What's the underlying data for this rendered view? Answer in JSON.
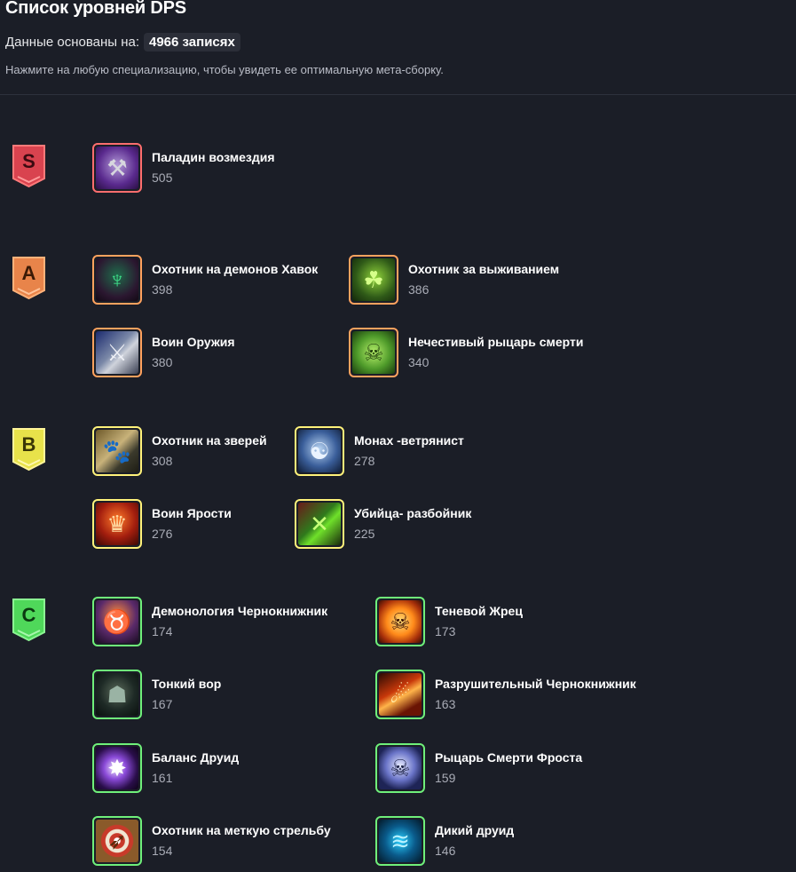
{
  "header": {
    "title": "Список уровней DPS",
    "basis_label": "Данные основаны на:",
    "basis_count": "4966 записях",
    "hint": "Нажмите на любую специализацию, чтобы увидеть ее оптимальную мета-сборку."
  },
  "colors": {
    "background": "#1b1e27",
    "tier_s": "#ff6e6e",
    "tier_a": "#ffa25e",
    "tier_b": "#fff27a",
    "tier_c": "#6ff07a"
  },
  "tiers": [
    {
      "letter": "S",
      "specs": [
        {
          "name": "Паладин возмездия",
          "count": "505",
          "icon": "hammer-icon"
        }
      ]
    },
    {
      "letter": "A",
      "specs": [
        {
          "name": "Охотник на демонов Хавок",
          "count": "398",
          "icon": "demon-hunter-icon"
        },
        {
          "name": "Охотник за выживанием",
          "count": "386",
          "icon": "survival-hunter-icon"
        },
        {
          "name": "Воин Оружия",
          "count": "380",
          "icon": "axe-icon"
        },
        {
          "name": "Нечестивый рыцарь смерти",
          "count": "340",
          "icon": "ghoul-icon"
        }
      ]
    },
    {
      "letter": "B",
      "specs": [
        {
          "name": "Охотник на зверей",
          "count": "308",
          "icon": "beast-icon"
        },
        {
          "name": "Монах -ветрянист",
          "count": "278",
          "icon": "windwalker-icon"
        },
        {
          "name": "Воин Ярости",
          "count": "276",
          "icon": "fury-icon"
        },
        {
          "name": "Убийца- разбойник",
          "count": "225",
          "icon": "daggers-icon"
        }
      ]
    },
    {
      "letter": "C",
      "specs": [
        {
          "name": "Демонология Чернокнижник",
          "count": "174",
          "icon": "demonology-icon"
        },
        {
          "name": "Теневой Жрец",
          "count": "173",
          "icon": "shadow-skull-icon"
        },
        {
          "name": "Тонкий вор",
          "count": "167",
          "icon": "hooded-rogue-icon"
        },
        {
          "name": "Разрушительный Чернокнижник",
          "count": "163",
          "icon": "fire-rain-icon"
        },
        {
          "name": "Баланс Друид",
          "count": "161",
          "icon": "starfall-icon"
        },
        {
          "name": "Рыцарь Смерти Фроста",
          "count": "159",
          "icon": "frost-skull-icon"
        },
        {
          "name": "Охотник на меткую стрельбу",
          "count": "154",
          "icon": "target-icon"
        },
        {
          "name": "Дикий друид",
          "count": "146",
          "icon": "claw-icon"
        }
      ]
    }
  ]
}
